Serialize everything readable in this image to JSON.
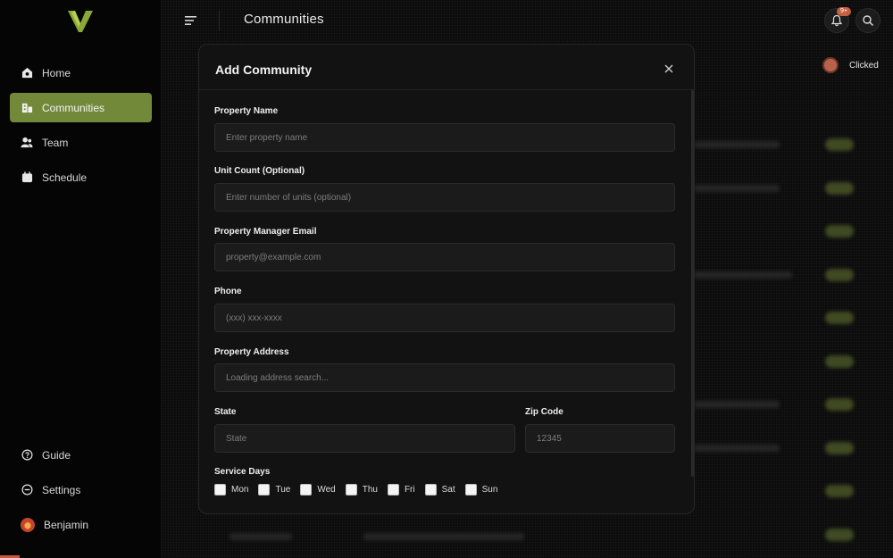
{
  "app": {
    "page_title": "Communities",
    "notification_badge": "9+",
    "clicked_label": "Clicked"
  },
  "sidebar": {
    "items": [
      {
        "label": "Home",
        "icon": "home-icon"
      },
      {
        "label": "Communities",
        "icon": "building-icon"
      },
      {
        "label": "Team",
        "icon": "team-icon"
      },
      {
        "label": "Schedule",
        "icon": "calendar-icon"
      }
    ],
    "bottom_items": [
      {
        "label": "Guide",
        "icon": "help-circle-icon"
      },
      {
        "label": "Settings",
        "icon": "settings-icon"
      }
    ],
    "user_name": "Benjamin"
  },
  "modal": {
    "title": "Add Community",
    "fields": {
      "property_name": {
        "label": "Property Name",
        "placeholder": "Enter property name"
      },
      "unit_count": {
        "label": "Unit Count (Optional)",
        "placeholder": "Enter number of units (optional)"
      },
      "manager_email": {
        "label": "Property Manager Email",
        "placeholder": "property@example.com"
      },
      "phone": {
        "label": "Phone",
        "placeholder": "(xxx) xxx-xxxx"
      },
      "address": {
        "label": "Property Address",
        "placeholder": "Loading address search..."
      },
      "state": {
        "label": "State",
        "placeholder": "State"
      },
      "zip": {
        "label": "Zip Code",
        "placeholder": "12345"
      }
    },
    "service_days_label": "Service Days",
    "days": [
      "Mon",
      "Tue",
      "Wed",
      "Thu",
      "Fri",
      "Sat",
      "Sun"
    ]
  },
  "colors": {
    "accent": "#73893a",
    "badge": "#c4603f"
  }
}
